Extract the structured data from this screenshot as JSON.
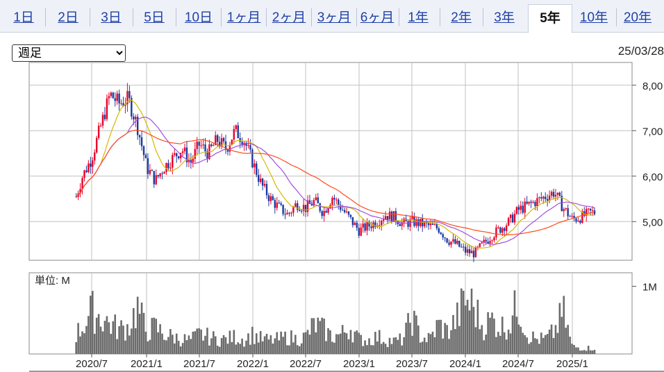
{
  "tabs": [
    {
      "label": "1日",
      "active": false
    },
    {
      "label": "2日",
      "active": false
    },
    {
      "label": "3日",
      "active": false
    },
    {
      "label": "5日",
      "active": false
    },
    {
      "label": "10日",
      "active": false
    },
    {
      "label": "1ヶ月",
      "active": false
    },
    {
      "label": "2ヶ月",
      "active": false
    },
    {
      "label": "3ヶ月",
      "active": false
    },
    {
      "label": "6ヶ月",
      "active": false
    },
    {
      "label": "1年",
      "active": false
    },
    {
      "label": "2年",
      "active": false
    },
    {
      "label": "3年",
      "active": false
    },
    {
      "label": "5年",
      "active": true
    },
    {
      "label": "10年",
      "active": false
    },
    {
      "label": "20年",
      "active": false
    }
  ],
  "period_select": {
    "value": "週足",
    "options": [
      "週足"
    ]
  },
  "date_label": "25/03/28",
  "colors": {
    "up": "#e8002a",
    "down": "#1a3a9e",
    "ma_short": "#d4b800",
    "ma_mid": "#a24ee0",
    "ma_long": "#ff4a1a",
    "volume": "#6b6b6b",
    "grid": "#c0c0c0"
  },
  "chart_data": [
    {
      "type": "candlestick",
      "title": "",
      "x_ticks": [
        "2020/7",
        "2021/1",
        "2021/7",
        "2022/1",
        "2022/7",
        "2023/1",
        "2023/7",
        "2024/1",
        "2024/7",
        "2025/1"
      ],
      "y_ticks": [
        "8,00",
        "7,00",
        "6,00",
        "5,00"
      ],
      "ylim": [
        4150,
        8500
      ],
      "moving_averages": [
        "short",
        "mid",
        "long"
      ],
      "close_path": [
        [
          "2020/5",
          5350
        ],
        [
          "2020/6",
          6000
        ],
        [
          "2020/7",
          6400
        ],
        [
          "2020/8",
          7100
        ],
        [
          "2020/9",
          7800
        ],
        [
          "2020/10",
          7600
        ],
        [
          "2020/11",
          7700
        ],
        [
          "2020/12",
          7100
        ],
        [
          "2021/1",
          6200
        ],
        [
          "2021/2",
          5900
        ],
        [
          "2021/3",
          6200
        ],
        [
          "2021/4",
          6400
        ],
        [
          "2021/5",
          6600
        ],
        [
          "2021/6",
          6300
        ],
        [
          "2021/7",
          6700
        ],
        [
          "2021/8",
          6500
        ],
        [
          "2021/9",
          6800
        ],
        [
          "2021/10",
          6600
        ],
        [
          "2021/11",
          7000
        ],
        [
          "2021/12",
          6800
        ],
        [
          "2022/1",
          6300
        ],
        [
          "2022/2",
          5800
        ],
        [
          "2022/3",
          5500
        ],
        [
          "2022/4",
          5300
        ],
        [
          "2022/5",
          5150
        ],
        [
          "2022/6",
          5400
        ],
        [
          "2022/7",
          5300
        ],
        [
          "2022/8",
          5450
        ],
        [
          "2022/9",
          5200
        ],
        [
          "2022/10",
          5550
        ],
        [
          "2022/11",
          5300
        ],
        [
          "2022/12",
          5050
        ],
        [
          "2023/1",
          4800
        ],
        [
          "2023/2",
          4900
        ],
        [
          "2023/3",
          5000
        ],
        [
          "2023/4",
          5150
        ],
        [
          "2023/5",
          5100
        ],
        [
          "2023/6",
          4950
        ],
        [
          "2023/7",
          5000
        ],
        [
          "2023/8",
          4950
        ],
        [
          "2023/9",
          4900
        ],
        [
          "2023/10",
          4850
        ],
        [
          "2023/11",
          4600
        ],
        [
          "2023/12",
          4500
        ],
        [
          "2024/1",
          4350
        ],
        [
          "2024/2",
          4300
        ],
        [
          "2024/3",
          4500
        ],
        [
          "2024/4",
          4700
        ],
        [
          "2024/5",
          4850
        ],
        [
          "2024/6",
          5000
        ],
        [
          "2024/7",
          5250
        ],
        [
          "2024/8",
          5350
        ],
        [
          "2024/9",
          5450
        ],
        [
          "2024/10",
          5550
        ],
        [
          "2024/11",
          5650
        ],
        [
          "2024/12",
          5300
        ],
        [
          "2025/1",
          5050
        ],
        [
          "2025/2",
          5100
        ],
        [
          "2025/3",
          5200
        ]
      ]
    },
    {
      "type": "bar",
      "title": "単位: M",
      "y_ticks": [
        "1M"
      ],
      "ylim": [
        0,
        1.2
      ],
      "x_ticks": [
        "2020/7",
        "2021/1",
        "2021/7",
        "2022/1",
        "2022/7",
        "2023/1",
        "2023/7",
        "2024/1",
        "2024/7",
        "2025/1"
      ],
      "values_monthly_peaks_M": [
        [
          "2020/5",
          0.35
        ],
        [
          "2020/6",
          0.55
        ],
        [
          "2020/7",
          0.88
        ],
        [
          "2020/8",
          0.75
        ],
        [
          "2020/9",
          0.62
        ],
        [
          "2020/10",
          0.5
        ],
        [
          "2020/11",
          0.55
        ],
        [
          "2020/12",
          0.95
        ],
        [
          "2021/1",
          0.45
        ],
        [
          "2021/2",
          0.55
        ],
        [
          "2021/3",
          0.4
        ],
        [
          "2021/4",
          0.35
        ],
        [
          "2021/5",
          0.3
        ],
        [
          "2021/6",
          0.28
        ],
        [
          "2021/7",
          0.4
        ],
        [
          "2021/8",
          0.35
        ],
        [
          "2021/9",
          0.3
        ],
        [
          "2021/10",
          0.3
        ],
        [
          "2021/11",
          0.35
        ],
        [
          "2021/12",
          0.3
        ],
        [
          "2022/1",
          0.4
        ],
        [
          "2022/2",
          0.3
        ],
        [
          "2022/3",
          0.28
        ],
        [
          "2022/4",
          0.3
        ],
        [
          "2022/5",
          0.35
        ],
        [
          "2022/6",
          0.3
        ],
        [
          "2022/7",
          0.35
        ],
        [
          "2022/8",
          0.6
        ],
        [
          "2022/9",
          0.5
        ],
        [
          "2022/10",
          0.35
        ],
        [
          "2022/11",
          0.4
        ],
        [
          "2022/12",
          0.55
        ],
        [
          "2023/1",
          0.3
        ],
        [
          "2023/2",
          0.28
        ],
        [
          "2023/3",
          0.35
        ],
        [
          "2023/4",
          0.3
        ],
        [
          "2023/5",
          0.25
        ],
        [
          "2023/6",
          0.3
        ],
        [
          "2023/7",
          0.75
        ],
        [
          "2023/8",
          0.35
        ],
        [
          "2023/9",
          0.3
        ],
        [
          "2023/10",
          0.6
        ],
        [
          "2023/11",
          0.45
        ],
        [
          "2023/12",
          0.7
        ],
        [
          "2024/1",
          1.1
        ],
        [
          "2024/2",
          0.95
        ],
        [
          "2024/3",
          0.55
        ],
        [
          "2024/4",
          0.7
        ],
        [
          "2024/5",
          0.55
        ],
        [
          "2024/6",
          0.6
        ],
        [
          "2024/7",
          1.05
        ],
        [
          "2024/8",
          0.4
        ],
        [
          "2024/9",
          0.3
        ],
        [
          "2024/10",
          0.3
        ],
        [
          "2024/11",
          0.45
        ],
        [
          "2024/12",
          0.85
        ],
        [
          "2025/1",
          0.15
        ],
        [
          "2025/2",
          0.12
        ],
        [
          "2025/3",
          0.12
        ]
      ]
    }
  ]
}
